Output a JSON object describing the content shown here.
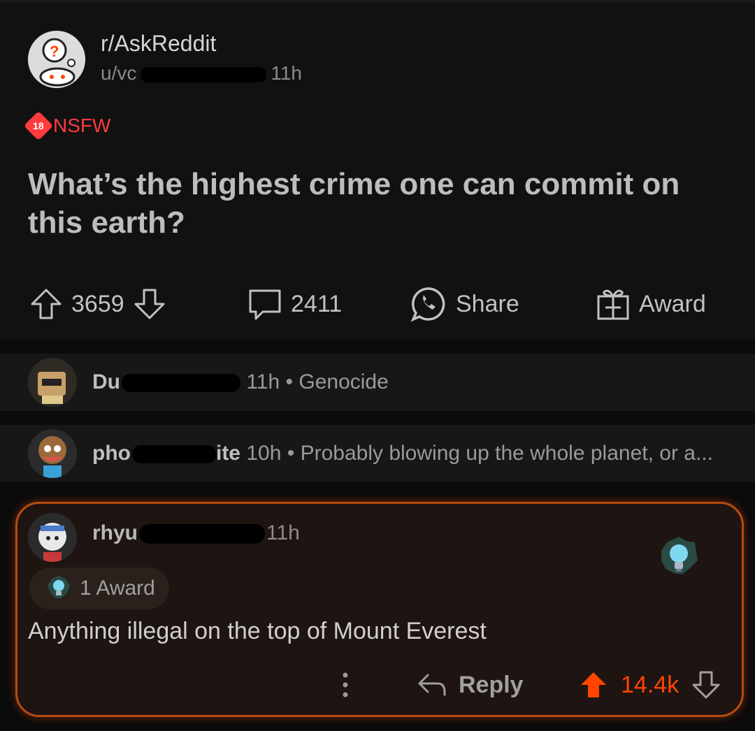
{
  "post": {
    "subreddit": "r/AskReddit",
    "user_prefix": "u/vc",
    "time": "11h",
    "nsfw_label": "NSFW",
    "nsfw_badge": "18",
    "title": "What’s the highest crime one can commit on this earth?",
    "upvotes": "3659",
    "comments": "2411",
    "share_label": "Share",
    "award_label": "Award"
  },
  "comments": [
    {
      "user": "Du",
      "time": "11h",
      "text": "Genocide"
    },
    {
      "user_start": "pho",
      "user_end": "ite",
      "time": "10h",
      "text": "Probably blowing up the whole planet, or a..."
    }
  ],
  "highlight": {
    "user": "rhyu",
    "time": "11h",
    "awards_label": "1 Award",
    "body": "Anything illegal on the top of Mount Everest",
    "reply_label": "Reply",
    "score": "14.4k",
    "more_icon": "•\n•\n•"
  },
  "colors": {
    "accent": "#ff4500",
    "nsfw": "#ff3b3b",
    "background": "#111111"
  }
}
